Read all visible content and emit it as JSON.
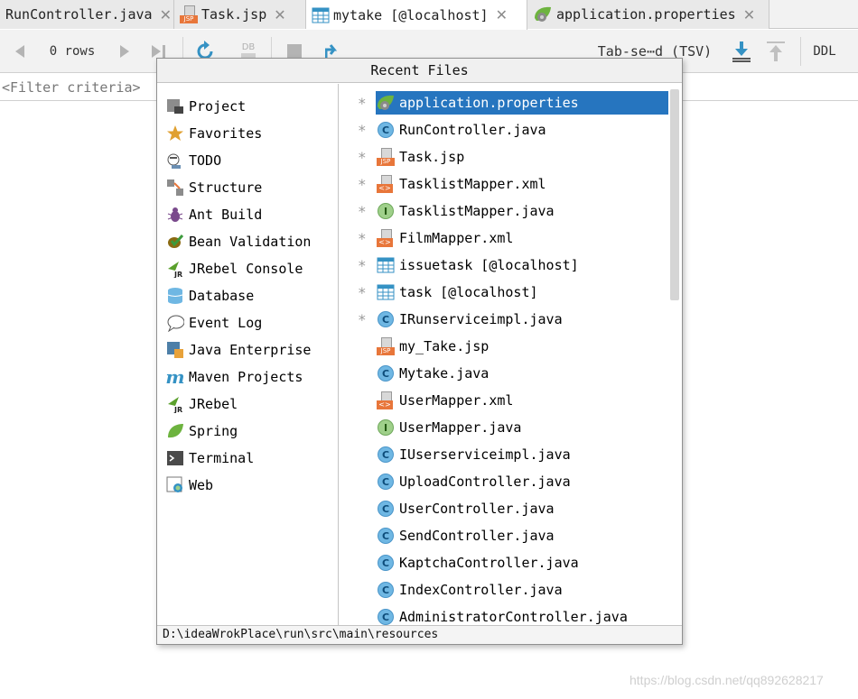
{
  "tabs": [
    {
      "label": "RunController.java",
      "icon": "java-class-icon",
      "active": false
    },
    {
      "label": "Task.jsp",
      "icon": "jsp-file-icon",
      "active": false
    },
    {
      "label": "mytake [@localhost]",
      "icon": "table-icon",
      "active": true
    },
    {
      "label": "application.properties",
      "icon": "spring-properties-icon",
      "active": false
    }
  ],
  "toolbar": {
    "rows_label": "0 rows",
    "db_label": "DB",
    "format_label": "Tab-se⋯d (TSV)",
    "ddl_label": "DDL"
  },
  "filter": {
    "placeholder": "<Filter criteria>"
  },
  "popup": {
    "title": "Recent Files",
    "tool_windows": [
      {
        "label": "Project",
        "icon": "project-icon"
      },
      {
        "label": "Favorites",
        "icon": "star-icon"
      },
      {
        "label": "TODO",
        "icon": "todo-icon"
      },
      {
        "label": "Structure",
        "icon": "structure-icon"
      },
      {
        "label": "Ant Build",
        "icon": "ant-icon"
      },
      {
        "label": "Bean Validation",
        "icon": "bean-validation-icon"
      },
      {
        "label": "JRebel Console",
        "icon": "jrebel-icon"
      },
      {
        "label": "Database",
        "icon": "database-icon"
      },
      {
        "label": "Event Log",
        "icon": "event-log-icon"
      },
      {
        "label": "Java Enterprise",
        "icon": "java-enterprise-icon"
      },
      {
        "label": "Maven Projects",
        "icon": "maven-icon"
      },
      {
        "label": "JRebel",
        "icon": "jrebel-icon"
      },
      {
        "label": "Spring",
        "icon": "spring-icon"
      },
      {
        "label": "Terminal",
        "icon": "terminal-icon"
      },
      {
        "label": "Web",
        "icon": "web-icon"
      }
    ],
    "recent_files": [
      {
        "label": "application.properties",
        "icon": "spring-properties-icon",
        "starred": true,
        "selected": true
      },
      {
        "label": "RunController.java",
        "icon": "java-class-icon",
        "starred": true
      },
      {
        "label": "Task.jsp",
        "icon": "jsp-file-icon",
        "starred": true
      },
      {
        "label": "TasklistMapper.xml",
        "icon": "xml-file-icon",
        "starred": true
      },
      {
        "label": "TasklistMapper.java",
        "icon": "java-interface-icon",
        "starred": true
      },
      {
        "label": "FilmMapper.xml",
        "icon": "xml-file-icon",
        "starred": true
      },
      {
        "label": "issuetask [@localhost]",
        "icon": "table-icon",
        "starred": true
      },
      {
        "label": "task [@localhost]",
        "icon": "table-icon",
        "starred": true
      },
      {
        "label": "IRunserviceimpl.java",
        "icon": "java-class-icon",
        "starred": true
      },
      {
        "label": "my_Take.jsp",
        "icon": "jsp-file-icon",
        "starred": false
      },
      {
        "label": "Mytake.java",
        "icon": "java-class-icon",
        "starred": false
      },
      {
        "label": "UserMapper.xml",
        "icon": "xml-file-icon",
        "starred": false
      },
      {
        "label": "UserMapper.java",
        "icon": "java-interface-icon",
        "starred": false
      },
      {
        "label": "IUserserviceimpl.java",
        "icon": "java-class-icon",
        "starred": false
      },
      {
        "label": "UploadController.java",
        "icon": "java-class-icon",
        "starred": false
      },
      {
        "label": "UserController.java",
        "icon": "java-class-icon",
        "starred": false
      },
      {
        "label": "SendController.java",
        "icon": "java-class-icon",
        "starred": false
      },
      {
        "label": "KaptchaController.java",
        "icon": "java-class-icon",
        "starred": false
      },
      {
        "label": "IndexController.java",
        "icon": "java-class-icon",
        "starred": false
      },
      {
        "label": "AdministratorController.java",
        "icon": "java-class-icon",
        "starred": false
      }
    ],
    "path": "D:\\ideaWrokPlace\\run\\src\\main\\resources"
  },
  "watermark": "https://blog.csdn.net/qq892628217",
  "colors": {
    "selection": "#2675bf",
    "accent": "#3592c4"
  }
}
